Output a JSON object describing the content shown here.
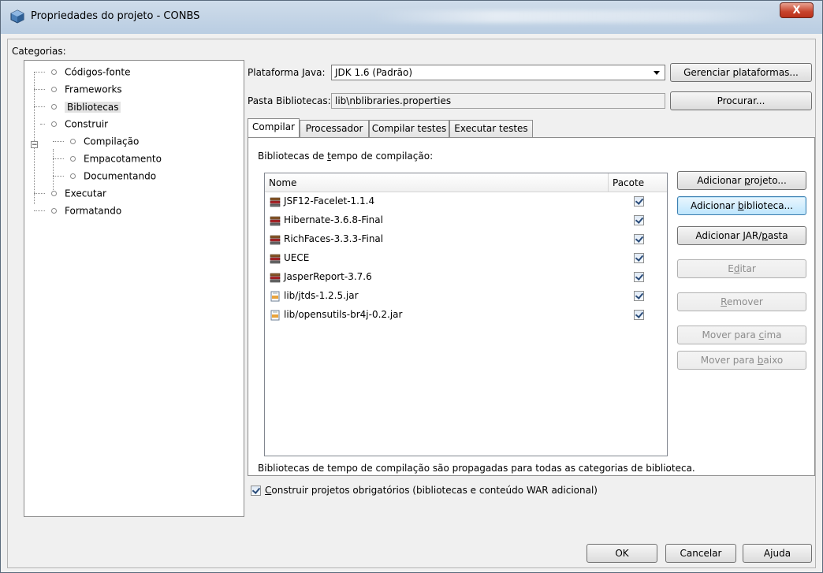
{
  "window": {
    "title": "Propriedades do projeto - CONBS",
    "close_label": "X"
  },
  "categories": {
    "label": "Categorias:",
    "items": [
      {
        "label": "Códigos-fonte",
        "level": 1
      },
      {
        "label": "Frameworks",
        "level": 1
      },
      {
        "label": "Bibliotecas",
        "level": 1,
        "selected": true
      },
      {
        "label": "Construir",
        "level": 1,
        "expanded": true
      },
      {
        "label": "Compilação",
        "level": 2
      },
      {
        "label": "Empacotamento",
        "level": 2
      },
      {
        "label": "Documentando",
        "level": 2
      },
      {
        "label": "Executar",
        "level": 1
      },
      {
        "label": "Formatando",
        "level": 1
      }
    ]
  },
  "platform": {
    "label": "Plataforma Java:",
    "value": "JDK 1.6 (Padrão)",
    "manage_button": "Gerenciar plataformas..."
  },
  "libfolder": {
    "label": "Pasta Bibliotecas:",
    "value": "lib\\nblibraries.properties",
    "browse_button": "Procurar..."
  },
  "tabs": [
    "Compilar",
    "Processador",
    "Compilar testes",
    "Executar testes"
  ],
  "compile": {
    "header_prefix": "Bibliotecas de ",
    "header_underline": "t",
    "header_suffix": "empo de compilação:",
    "columns": {
      "name": "Nome",
      "package": "Pacote"
    },
    "rows": [
      {
        "name": "JSF12-Facelet-1.1.4",
        "type": "library",
        "checked": true
      },
      {
        "name": "Hibernate-3.6.8-Final",
        "type": "library",
        "checked": true
      },
      {
        "name": "RichFaces-3.3.3-Final",
        "type": "library",
        "checked": true
      },
      {
        "name": "UECE",
        "type": "library",
        "checked": true
      },
      {
        "name": "JasperReport-3.7.6",
        "type": "library",
        "checked": true
      },
      {
        "name": "lib/jtds-1.2.5.jar",
        "type": "jar",
        "checked": true
      },
      {
        "name": "lib/opensutils-br4j-0.2.jar",
        "type": "jar",
        "checked": true
      }
    ],
    "footer_note": "Bibliotecas de tempo de compilação são propagadas para todas as categorias de biblioteca."
  },
  "side_buttons": {
    "add_project_pre": "Adicionar ",
    "add_project_u": "p",
    "add_project_post": "rojeto...",
    "add_library_pre": "Adicionar ",
    "add_library_u": "b",
    "add_library_post": "iblioteca...",
    "add_jar_pre": "Adicionar JAR/",
    "add_jar_u": "p",
    "add_jar_post": "asta",
    "edit_pre": "E",
    "edit_u": "d",
    "edit_post": "itar",
    "remove_pre": "",
    "remove_u": "R",
    "remove_post": "emover",
    "move_up_pre": "Mover para ",
    "move_up_u": "c",
    "move_up_post": "ima",
    "move_down_pre": "Mover para ",
    "move_down_u": "b",
    "move_down_post": "aixo"
  },
  "build_required": {
    "checked": true,
    "label_u": "C",
    "label_rest": "onstruir projetos obrigatórios (bibliotecas e conteúdo WAR adicional)"
  },
  "dialog_buttons": {
    "ok": "OK",
    "cancel": "Cancelar",
    "help_pre": "A",
    "help_u": "j",
    "help_post": "uda"
  }
}
